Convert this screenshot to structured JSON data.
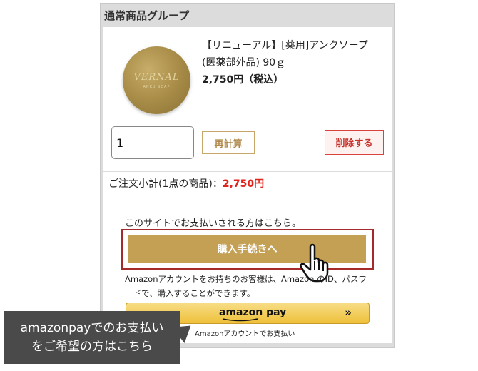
{
  "group": {
    "title": "通常商品グループ"
  },
  "product": {
    "name_line1": "【リニューアル】[薬用]アンクソープ",
    "name_line2": "(医薬部外品) 90ｇ",
    "price": "2,750円（税込）",
    "image_brand": "VERNAL",
    "image_subtext": "ANKU SOAP"
  },
  "cart": {
    "quantity": "1",
    "recalc_label": "再計算",
    "delete_label": "削除する",
    "subtotal_label": "ご注文小計(1点の商品)：",
    "subtotal_amount": "2,750円"
  },
  "checkout": {
    "site_note": "このサイトでお支払いされる方はこちら。",
    "button_label": "購入手続きへ",
    "amazon_note": "Amazonアカウントをお持ちのお客様は、Amazon のID、パスワードで、購入することができます。",
    "amazon_logo": "amazon pay",
    "amazon_arrows": "»",
    "amazon_caption": "Amazonアカウントでお支払い"
  },
  "callout": {
    "line1": "amazonpayでのお支払い",
    "line2": "をご希望の方はこちら"
  },
  "colors": {
    "accent_gold": "#c4a055",
    "price_red": "#e0241c",
    "delete_red": "#c8302a",
    "highlight_frame": "#a52a2a",
    "amazon_yellow": "#eec03a"
  }
}
